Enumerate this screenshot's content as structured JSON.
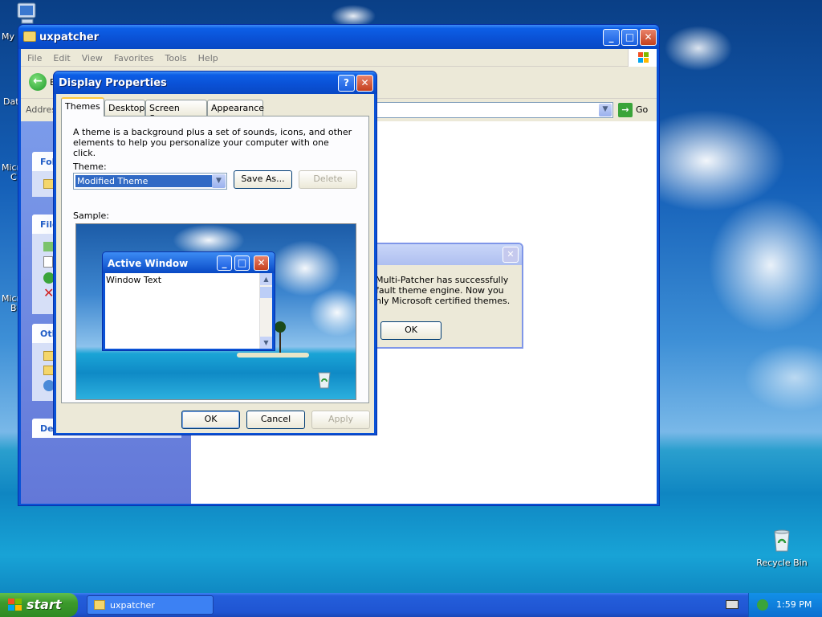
{
  "desktop": {
    "icons": [
      {
        "label": "My",
        "icon": "computer-icon"
      },
      {
        "label": "Dat",
        "icon": "folder-icon"
      },
      {
        "label": "Micro\nC",
        "icon": "app-icon"
      },
      {
        "label": "Micro\nB",
        "icon": "app-icon"
      },
      {
        "label": "Recycle Bin",
        "icon": "recycle-bin-icon"
      }
    ]
  },
  "explorer": {
    "title": "uxpatcher",
    "menu": [
      "File",
      "Edit",
      "View",
      "Favorites",
      "Tools",
      "Help"
    ],
    "back_label": "B",
    "address_label": "Addres",
    "go_label": "Go",
    "taskpane": {
      "box1_header": "Fol",
      "box2_header": "File",
      "box3_header": "Oth",
      "box4_header": "De"
    }
  },
  "message_box": {
    "text_line1": "Multi-Patcher has successfully",
    "text_line2": "fault theme engine. Now you",
    "text_line3": "nly Microsoft certified themes.",
    "ok_label": "OK"
  },
  "display_properties": {
    "title": "Display Properties",
    "tabs": [
      "Themes",
      "Desktop",
      "Screen Saver",
      "Appearance"
    ],
    "description": "A theme is a background plus a set of sounds, icons, and other elements to help you personalize your computer with one click.",
    "theme_label": "Theme:",
    "theme_value": "Modified Theme",
    "save_as_label": "Save As...",
    "delete_label": "Delete",
    "sample_label": "Sample:",
    "active_window_title": "Active Window",
    "window_text": "Window Text",
    "ok_label": "OK",
    "cancel_label": "Cancel",
    "apply_label": "Apply"
  },
  "taskbar": {
    "start_label": "start",
    "task_label": "uxpatcher",
    "clock": "1:59 PM"
  },
  "colors": {
    "title_blue": "#0a52d6",
    "taskbar_blue": "#245edb",
    "start_green": "#3c9a2c"
  }
}
